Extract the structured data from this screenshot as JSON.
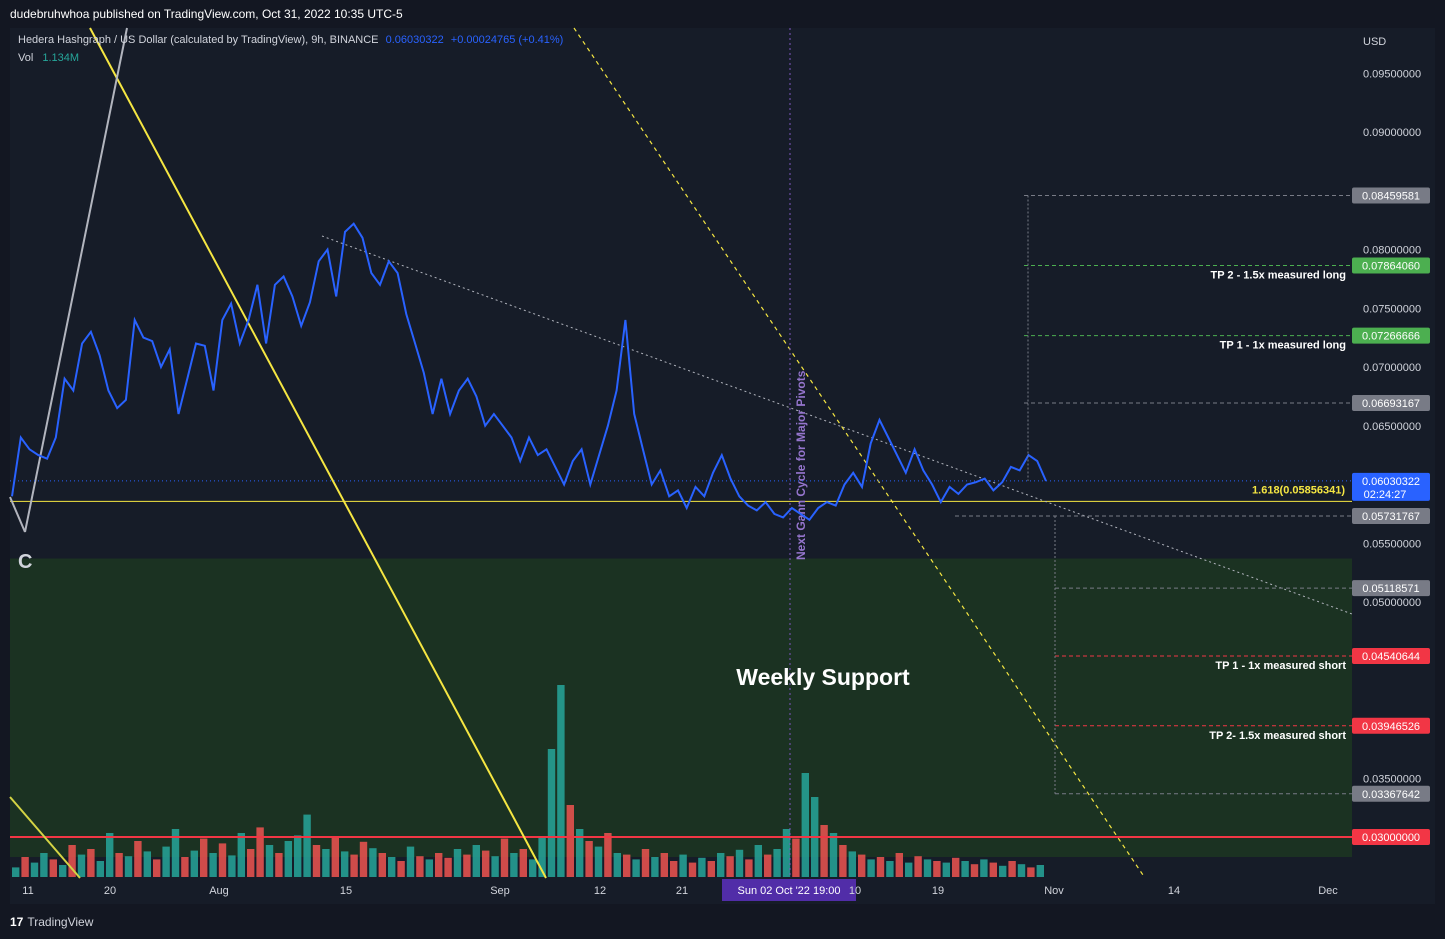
{
  "header": {
    "publisher": "dudebruhwhoa published on TradingView.com, Oct 31, 2022 10:35 UTC-5"
  },
  "footer": {
    "brand": "TradingView",
    "logo_icon": "tradingview-logo-icon"
  },
  "legend": {
    "symbol": "Hedera Hashgraph / US Dollar (calculated by TradingView), 9h, BINANCE",
    "price": "0.06030322",
    "change": "+0.00024765 (+0.41%)",
    "vol_label": "Vol",
    "vol_value": "1.134M"
  },
  "colors": {
    "price_line": "#2962ff",
    "support_zone": "#1b3222",
    "fib_line": "#f5e642",
    "ma_line": "#f5e642",
    "green_label": "#4caf50",
    "red_label": "#f23645",
    "gray_label": "#787b86",
    "vol_up": "#26a69a",
    "vol_down": "#ef5350",
    "cycle_line": "#7e57c2"
  },
  "chart_data": {
    "type": "line",
    "title": "",
    "currency_label": "USD",
    "xlabel": "",
    "ylabel": "",
    "ylim": [
      0.0285,
      0.1005
    ],
    "x_ticks": [
      "11",
      "20",
      "Aug",
      "15",
      "Sep",
      "12",
      "21",
      "Sun 02 Oct '22   19:00",
      "10",
      "19",
      "Nov",
      "14",
      "Dec"
    ],
    "y_ticks": [
      "0.09500000",
      "0.09000000",
      "0.08000000",
      "0.07500000",
      "0.07000000",
      "0.06500000",
      "0.05500000",
      "0.05000000",
      "0.03500000"
    ],
    "series": [
      {
        "values": [
          0.059,
          0.064,
          0.063,
          0.0625,
          0.0622,
          0.064,
          0.069,
          0.068,
          0.072,
          0.073,
          0.071,
          0.068,
          0.0665,
          0.0672,
          0.074,
          0.0725,
          0.0722,
          0.07,
          0.0715,
          0.066,
          0.069,
          0.072,
          0.0718,
          0.068,
          0.074,
          0.0754,
          0.072,
          0.074,
          0.077,
          0.072,
          0.077,
          0.0777,
          0.076,
          0.0735,
          0.0755,
          0.079,
          0.08,
          0.076,
          0.0815,
          0.0822,
          0.081,
          0.078,
          0.077,
          0.079,
          0.078,
          0.0745,
          0.072,
          0.0695,
          0.066,
          0.069,
          0.066,
          0.068,
          0.069,
          0.0675,
          0.065,
          0.066,
          0.065,
          0.064,
          0.062,
          0.064,
          0.0625,
          0.063,
          0.0615,
          0.06,
          0.062,
          0.063,
          0.06,
          0.0625,
          0.065,
          0.068,
          0.074,
          0.066,
          0.063,
          0.06,
          0.0612,
          0.059,
          0.0595,
          0.058,
          0.0598,
          0.059,
          0.061,
          0.0625,
          0.0605,
          0.059,
          0.0582,
          0.0578,
          0.0585,
          0.0575,
          0.0572,
          0.058,
          0.0575,
          0.057,
          0.058,
          0.0585,
          0.0582,
          0.06,
          0.061,
          0.0598,
          0.0635,
          0.0655,
          0.064,
          0.0625,
          0.061,
          0.063,
          0.0612,
          0.06,
          0.0585,
          0.0598,
          0.0592,
          0.06,
          0.0602,
          0.0605,
          0.0595,
          0.0602,
          0.0615,
          0.0612,
          0.0625,
          0.062,
          0.0603
        ],
        "color": "#2962ff"
      }
    ],
    "volume": {
      "label": "Vol",
      "last": "1.134M",
      "values": [
        0.12,
        0.25,
        0.18,
        0.3,
        0.22,
        0.15,
        0.4,
        0.28,
        0.35,
        0.2,
        0.55,
        0.3,
        0.26,
        0.45,
        0.32,
        0.22,
        0.38,
        0.6,
        0.25,
        0.33,
        0.48,
        0.3,
        0.42,
        0.27,
        0.55,
        0.35,
        0.62,
        0.4,
        0.3,
        0.45,
        0.52,
        0.78,
        0.4,
        0.35,
        0.5,
        0.32,
        0.28,
        0.44,
        0.36,
        0.3,
        0.25,
        0.2,
        0.38,
        0.26,
        0.22,
        0.3,
        0.24,
        0.35,
        0.28,
        0.4,
        0.33,
        0.26,
        0.48,
        0.3,
        0.35,
        0.22,
        0.5,
        1.6,
        2.4,
        0.9,
        0.6,
        0.45,
        0.38,
        0.55,
        0.3,
        0.28,
        0.22,
        0.35,
        0.25,
        0.3,
        0.2,
        0.28,
        0.18,
        0.24,
        0.2,
        0.3,
        0.26,
        0.34,
        0.22,
        0.4,
        0.28,
        0.35,
        0.6,
        0.48,
        1.3,
        1.0,
        0.65,
        0.55,
        0.4,
        0.32,
        0.28,
        0.22,
        0.25,
        0.2,
        0.3,
        0.18,
        0.26,
        0.22,
        0.2,
        0.18,
        0.24,
        0.2,
        0.16,
        0.22,
        0.18,
        0.14,
        0.2,
        0.16,
        0.12,
        0.15
      ],
      "up_down": [
        1,
        0,
        1,
        1,
        0,
        1,
        0,
        1,
        0,
        1,
        1,
        0,
        1,
        0,
        1,
        0,
        1,
        1,
        0,
        1,
        0,
        1,
        0,
        1,
        1,
        0,
        0,
        1,
        0,
        1,
        1,
        1,
        0,
        1,
        0,
        1,
        0,
        0,
        1,
        0,
        1,
        0,
        1,
        0,
        1,
        0,
        0,
        1,
        0,
        1,
        0,
        1,
        0,
        1,
        0,
        1,
        1,
        1,
        1,
        0,
        1,
        0,
        1,
        0,
        1,
        0,
        1,
        0,
        1,
        0,
        0,
        1,
        0,
        1,
        0,
        1,
        0,
        1,
        0,
        1,
        0,
        1,
        1,
        0,
        1,
        1,
        0,
        1,
        0,
        1,
        0,
        1,
        0,
        1,
        0,
        1,
        0,
        1,
        0,
        1,
        0,
        1,
        0,
        1,
        0,
        1,
        0,
        1,
        0,
        1
      ]
    },
    "annotations": {
      "fib_label": "1.618(0.05856341)",
      "fib_value": 0.05856341,
      "cycle_label": "Next Gann Cycle for Major Pivots",
      "support_label": "Weekly Support",
      "support_zone": [
        0.03,
        0.0537
      ],
      "wave_label": "C",
      "targets": [
        {
          "text": "TP 2 - 1.5x measured long",
          "value": 0.0786406
        },
        {
          "text": "TP 1 - 1x measured long",
          "value": 0.07266666
        },
        {
          "text": "TP 1 - 1x measured short",
          "value": 0.04540644
        },
        {
          "text": "TP 2- 1.5x measured short",
          "value": 0.03946526
        }
      ]
    },
    "price_labels": [
      {
        "text": "0.08459581",
        "value": 0.08459581,
        "kind": "gray"
      },
      {
        "text": "0.07864060",
        "value": 0.0786406,
        "kind": "green"
      },
      {
        "text": "0.07266666",
        "value": 0.07266666,
        "kind": "green"
      },
      {
        "text": "0.06693167",
        "value": 0.06693167,
        "kind": "gray"
      },
      {
        "text": "0.06030322",
        "value": 0.06030322,
        "kind": "current",
        "sub": "02:24:27"
      },
      {
        "text": "0.05731767",
        "value": 0.05731767,
        "kind": "gray"
      },
      {
        "text": "0.05118571",
        "value": 0.05118571,
        "kind": "gray"
      },
      {
        "text": "0.04540644",
        "value": 0.04540644,
        "kind": "red"
      },
      {
        "text": "0.03946526",
        "value": 0.03946526,
        "kind": "red"
      },
      {
        "text": "0.03367642",
        "value": 0.03367642,
        "kind": "gray"
      },
      {
        "text": "0.03000000",
        "value": 0.03,
        "kind": "red"
      }
    ]
  }
}
